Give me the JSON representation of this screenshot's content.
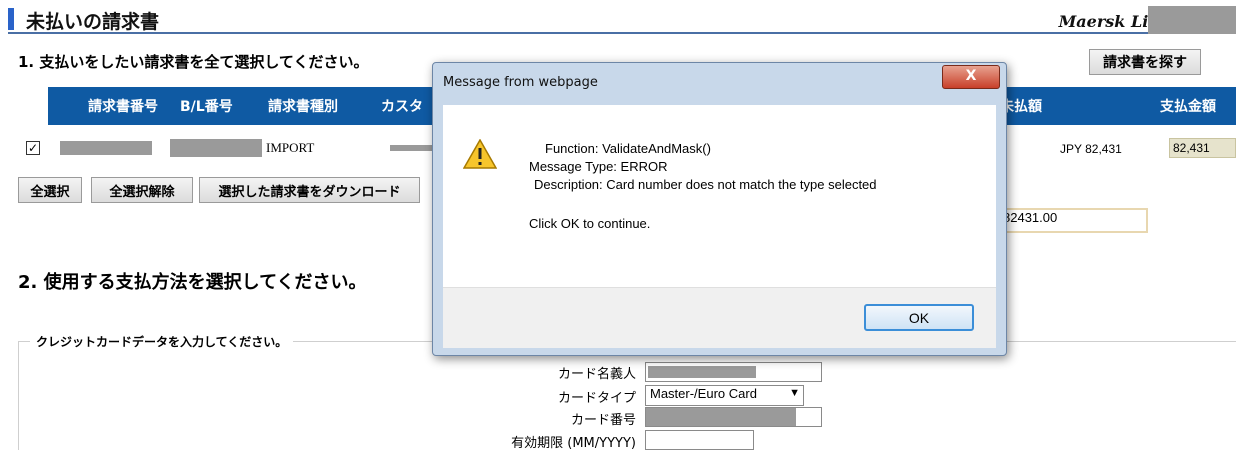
{
  "header": {
    "title": "未払いの請求書",
    "brand": "Maersk Line:"
  },
  "section1": {
    "label": "1. 支払いをしたい請求書を全て選択してください。",
    "find_button": "請求書を探す",
    "columns": [
      "請求書番号",
      "B/L番号",
      "請求書種別",
      "カスタ",
      "未払額",
      "支払金額"
    ],
    "row": {
      "checked": "✓",
      "type": "IMPORT",
      "unpaid": "JPY 82,431",
      "pay_amount": "82,431"
    },
    "buttons": {
      "select_all": "全選択",
      "deselect_all": "全選択解除",
      "download": "選択した請求書をダウンロード"
    },
    "total": "82431.00"
  },
  "section2": {
    "label": "2. 使用する支払方法を選択してください。",
    "legend": "クレジットカードデータを入力してください。",
    "fields": {
      "card_holder": "カード名義人",
      "card_type": "カードタイプ",
      "card_type_value": "Master-/Euro Card",
      "card_number": "カード番号",
      "expiry": "有効期限 (MM/YYYY)"
    }
  },
  "dialog": {
    "title": "Message from webpage",
    "close": "X",
    "function_line": "Function:  ValidateAndMask()",
    "type_line": "Message Type:  ERROR",
    "description_line": "Description:  Card number does not match the type selected",
    "continue_line": "Click OK to continue.",
    "ok": "OK"
  },
  "colors": {
    "table_header": "#0f5aa3",
    "title_accent": "#2a63c9",
    "redaction": "#9a9a9a"
  }
}
